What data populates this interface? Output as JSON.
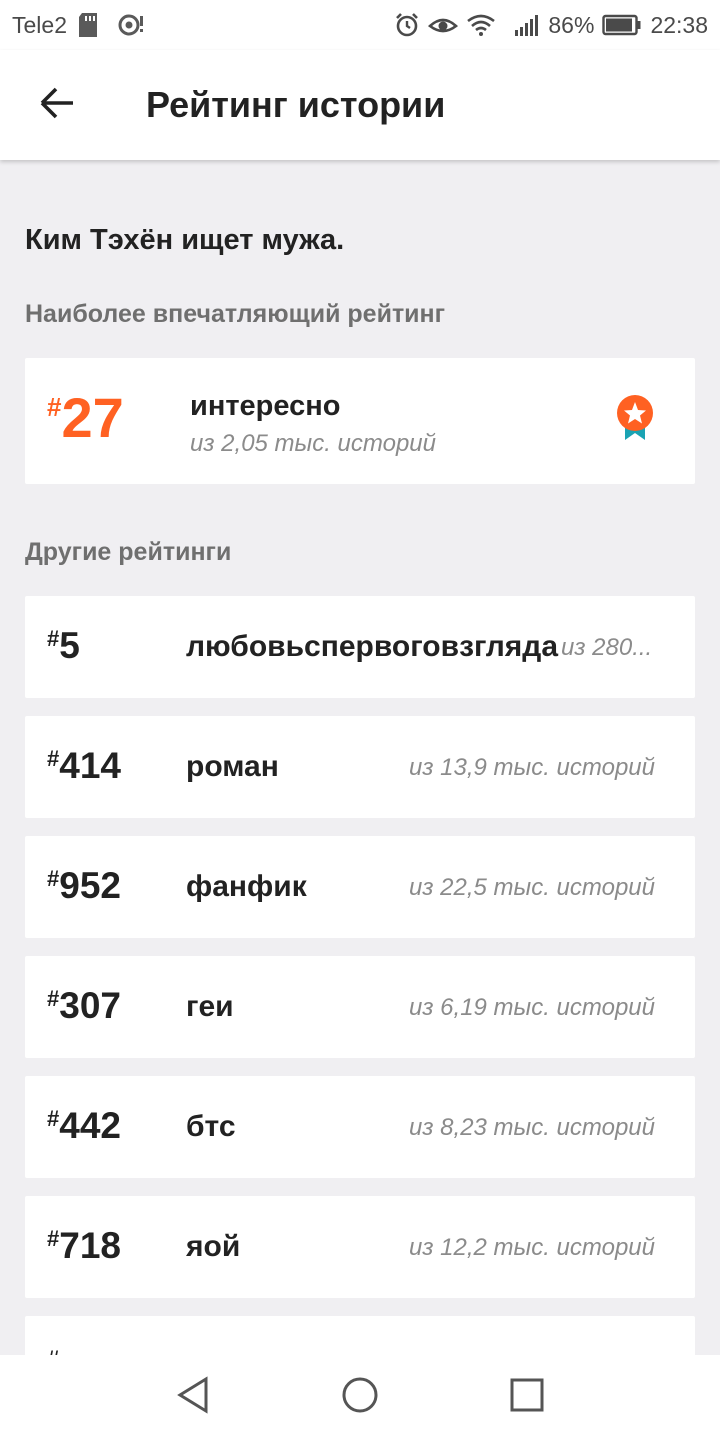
{
  "status_bar": {
    "carrier": "Tele2",
    "battery": "86%",
    "time": "22:38"
  },
  "app_bar": {
    "title": "Рейтинг истории"
  },
  "story": {
    "title": "Ким Тэхён ищет мужа."
  },
  "sections": {
    "top_label": "Наиболее впечатляющий рейтинг",
    "other_label": "Другие рейтинги"
  },
  "top_rating": {
    "hash": "#",
    "rank": "27",
    "tag": "интересно",
    "subtitle": "из 2,05 тыс. историй"
  },
  "ratings": [
    {
      "hash": "#",
      "rank": "5",
      "tag": "любовьспервоговзгляда",
      "subtitle": "из 280..."
    },
    {
      "hash": "#",
      "rank": "414",
      "tag": "роман",
      "subtitle": "из 13,9 тыс. историй"
    },
    {
      "hash": "#",
      "rank": "952",
      "tag": "фанфик",
      "subtitle": "из 22,5 тыс. историй"
    },
    {
      "hash": "#",
      "rank": "307",
      "tag": "геи",
      "subtitle": "из 6,19 тыс. историй"
    },
    {
      "hash": "#",
      "rank": "442",
      "tag": "бтс",
      "subtitle": "из 8,23 тыс. историй"
    },
    {
      "hash": "#",
      "rank": "718",
      "tag": "яой",
      "subtitle": "из 12,2 тыс. историй"
    },
    {
      "hash": "#",
      "rank": "",
      "tag": "",
      "subtitle": ""
    }
  ],
  "colors": {
    "accent": "#ff6122",
    "badge_ribbon": "#1aa3b3",
    "background": "#f0eff2"
  },
  "icons": {
    "back": "arrow-left-icon",
    "badge": "award-badge-icon",
    "nav_back": "triangle-back-icon",
    "nav_home": "circle-home-icon",
    "nav_recents": "square-recents-icon"
  }
}
